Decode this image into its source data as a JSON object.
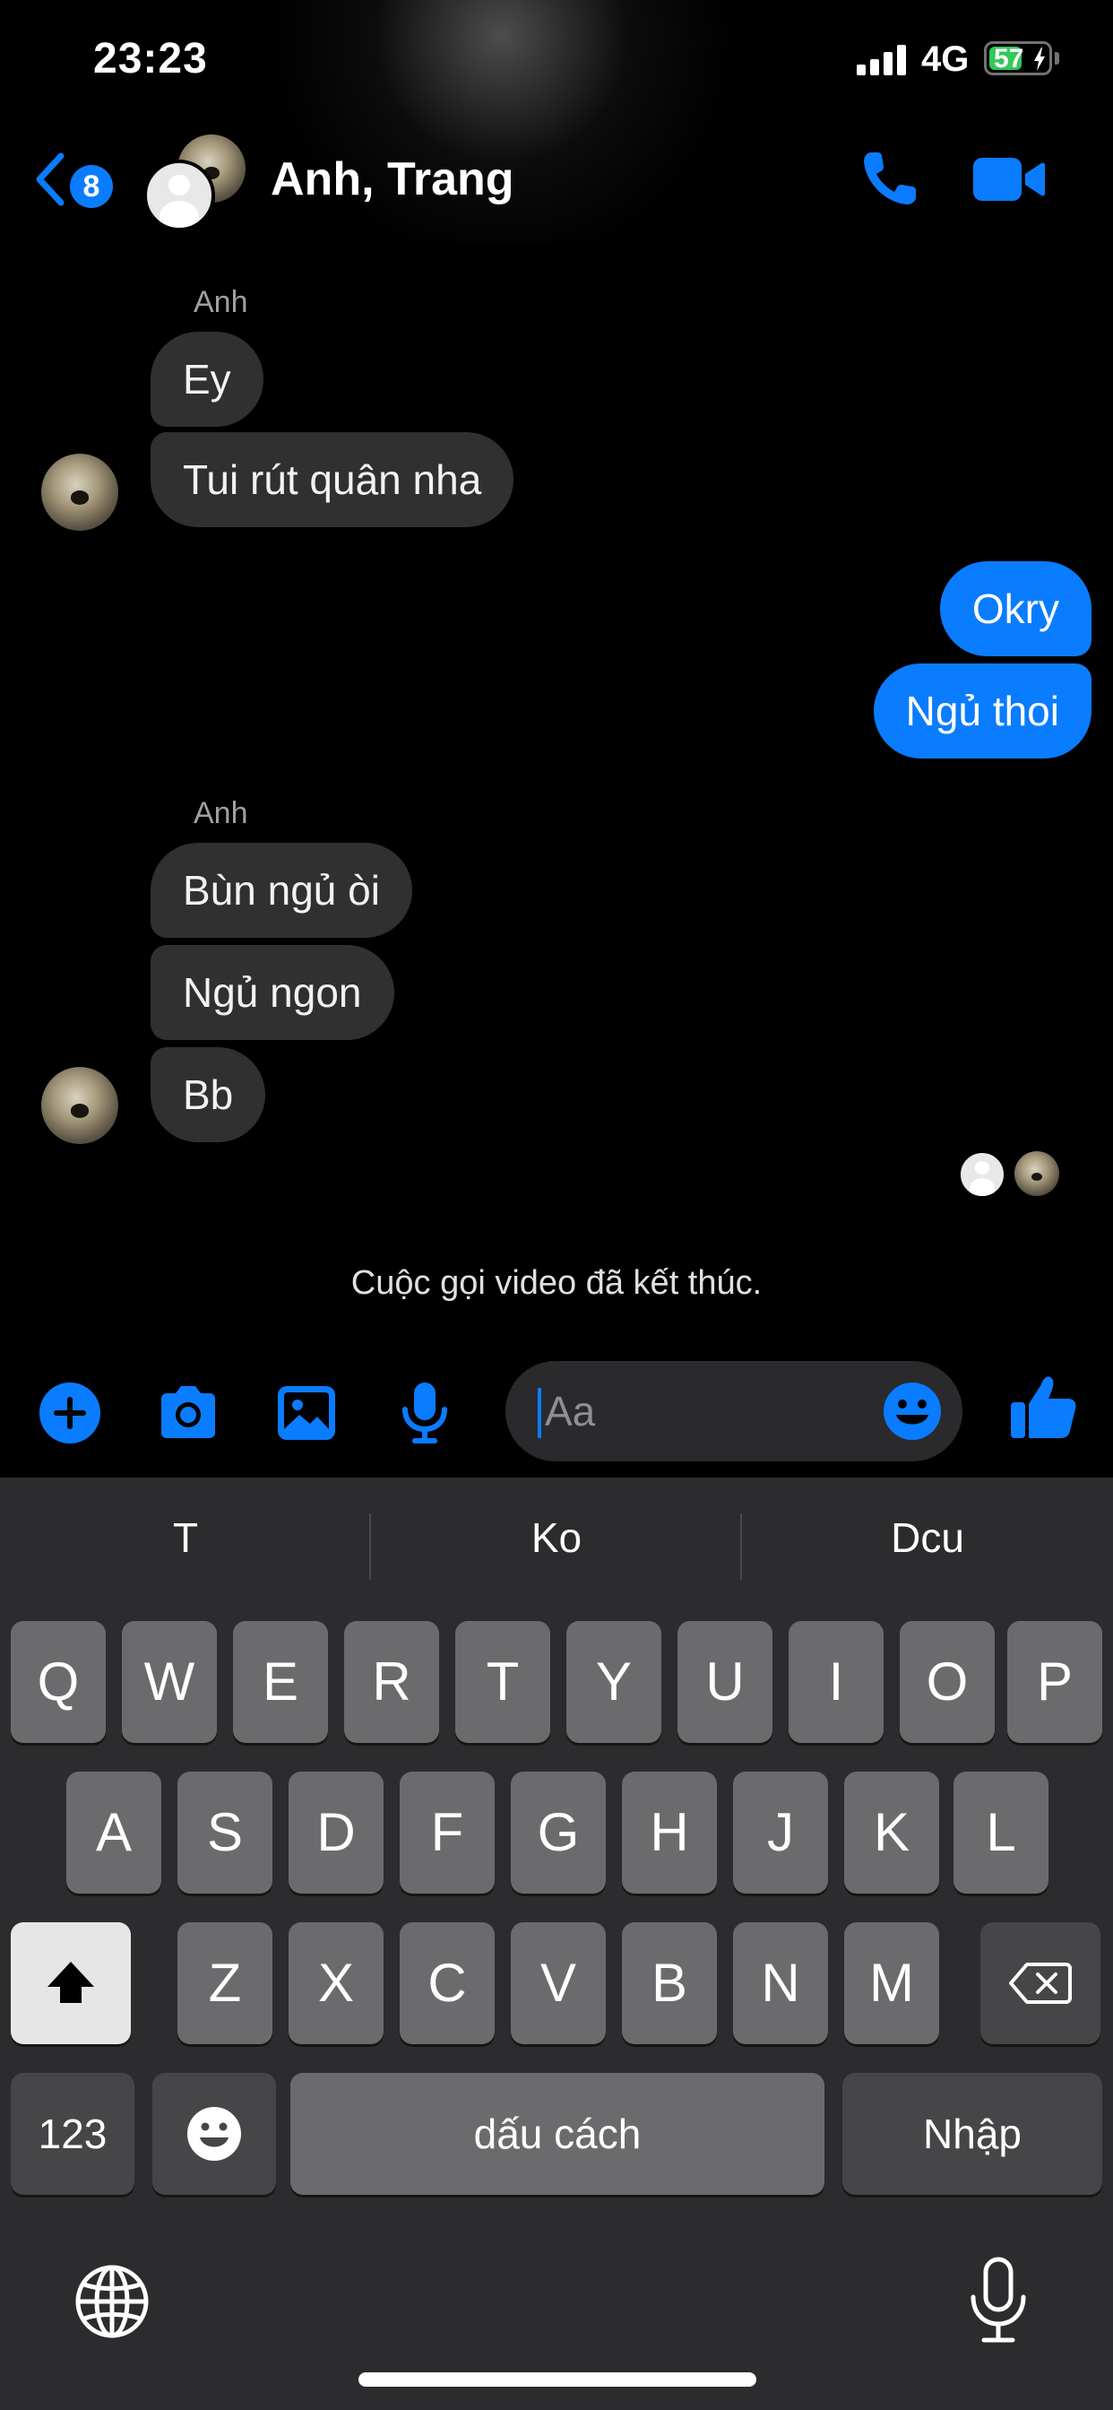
{
  "status_bar": {
    "time": "23:23",
    "network": "4G",
    "battery": "57",
    "battery_level": 0.57,
    "battery_color": "#34c759"
  },
  "header": {
    "back_badge": "8",
    "title": "Anh, Trang",
    "accent_color": "#0a7cff",
    "icons": [
      "chevron-left-icon",
      "phone-icon",
      "video-camera-icon"
    ]
  },
  "messages": [
    {
      "sender": "Anh",
      "direction": "in",
      "text": "Ey"
    },
    {
      "direction": "in",
      "text": "Tui rút quân nha"
    },
    {
      "direction": "out",
      "text": "Okry"
    },
    {
      "direction": "out",
      "text": "Ngủ thoi"
    },
    {
      "sender": "Anh",
      "direction": "in",
      "text": "Bùn ngủ òi"
    },
    {
      "direction": "in",
      "text": "Ngủ ngon"
    },
    {
      "direction": "in",
      "text": "Bb"
    }
  ],
  "system_message": "Cuộc gọi video đã kết thúc.",
  "composer": {
    "placeholder": "Aa",
    "icons": [
      "plus-icon",
      "camera-icon",
      "photo-icon",
      "microphone-icon",
      "emoji-icon",
      "thumbs-up-icon"
    ]
  },
  "keyboard": {
    "suggestions": [
      "T",
      "Ko",
      "Dcu"
    ],
    "row1": [
      "Q",
      "W",
      "E",
      "R",
      "T",
      "Y",
      "U",
      "I",
      "O",
      "P"
    ],
    "row2": [
      "A",
      "S",
      "D",
      "F",
      "G",
      "H",
      "J",
      "K",
      "L"
    ],
    "row3": [
      "Z",
      "X",
      "C",
      "V",
      "B",
      "N",
      "M"
    ],
    "numbers_key": "123",
    "space_key": "dấu cách",
    "return_key": "Nhập",
    "icons": [
      "shift-icon",
      "delete-icon",
      "emoji-key-icon",
      "globe-icon",
      "dictation-icon"
    ]
  }
}
